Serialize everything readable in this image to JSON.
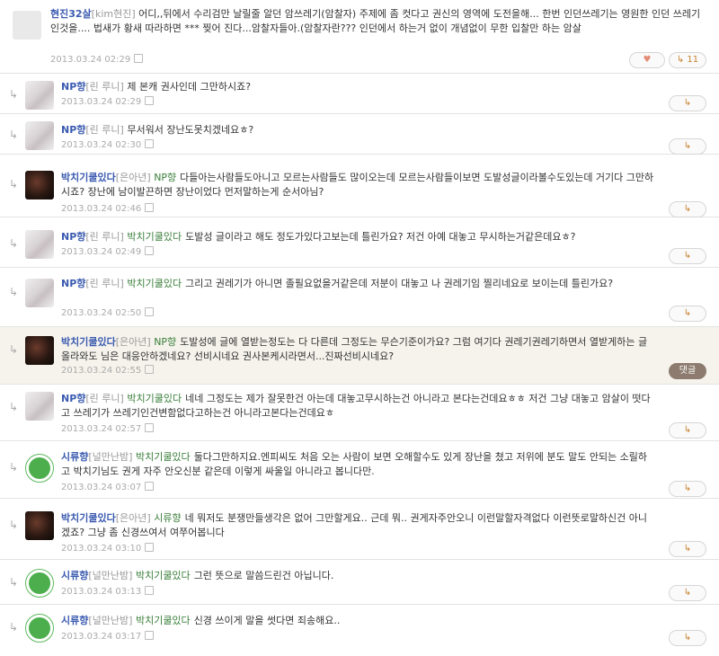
{
  "icons": {
    "reply_arrow": "↳",
    "reply": "↳",
    "heart": "♥"
  },
  "comments": [
    {
      "author": "현진32살",
      "nick": "[kim현진]",
      "target": "",
      "text": "어디,,뒤에서 수리검만 날릴줄 알던 암쓰레기(암찰자) 주제에 좀 컷다고 권신의 영역에 도전을해... 한번 인던쓰레기는 영원한 인던 쓰레기인것을.... 법새가 황새 따라하면 *** 찢어 진다...암찰자들아.(암찰자란??? 인던에서 하는거 없이 개념없이 무한 입찰만 하는 암살",
      "time": "2013.03.24 02:29",
      "likes": "11"
    },
    {
      "author": "NP향",
      "nick": "[린 루니]",
      "target": "",
      "text": "제 본캐 권사인데 그만하시죠?",
      "time": "2013.03.24 02:29"
    },
    {
      "author": "NP향",
      "nick": "[린 루니]",
      "target": "",
      "text": "무서워서 장난도못치겠네요ㅎ?",
      "time": "2013.03.24 02:30"
    },
    {
      "author": "박치기쿨있다",
      "nick": "[은아년]",
      "target": "NP향",
      "text": "다들아는사람들도아니고 모르는사람들도 많이오는데 모르는사람들이보면 도발성글이라볼수도있는데 거기다 그만하시죠? 장난에 남이발끈하면 장난이었다 먼저말하는게 순서아님?",
      "time": "2013.03.24 02:46"
    },
    {
      "author": "NP향",
      "nick": "[린 루니]",
      "target": "박치기쿨있다",
      "text": "도발성 글이라고 해도 정도가있다고보는데 틀린가요? 저건 아예 대놓고 무시하는거같은데요ㅎ?",
      "time": "2013.03.24 02:49"
    },
    {
      "author": "NP향",
      "nick": "[린 루니]",
      "target": "박치기쿨있다",
      "text": "그리고 권레기가 아니면 졸필요없을거같은데 저분이 대놓고 나 권레기임 찔리네요로 보이는데 틀린가요?",
      "time": "2013.03.24 02:50"
    },
    {
      "author": "박치기쿨있다",
      "nick": "[은아년]",
      "target": "NP향",
      "text": "도발성에 글에 열받는정도는 다 다른데 그정도는 무슨기준이가요? 그럼 여기다 권레기권레기하면서 열받게하는 글 올라와도 님은 대응안하겠네요? 선비시네요 권사본케시라면서...진짜선비시네요?",
      "time": "2013.03.24 02:55",
      "reply_label": "댓글"
    },
    {
      "author": "NP향",
      "nick": "[린 루니]",
      "target": "박치기쿨있다",
      "text": "네네 그정도는 제가 잘못한건 아는데 대놓고무시하는건 아니라고 본다는건데요ㅎㅎ 저건 그냥 대놓고 암살이 떳다고 쓰레기가 쓰레기인건변함없다고하는건 아니라고본다는건데요ㅎ",
      "time": "2013.03.24 02:57"
    },
    {
      "author": "시류향",
      "nick": "[널만난밤]",
      "target": "박치기쿨있다",
      "text": "둘다그만하지요.엔피씨도 처음 오는 사람이 보면 오해할수도 있게 장난을 쳤고 저위에 분도 말도 안되는 소릴하고 박치기님도 권게 자주 안오신분 같은데 이렇게 싸울일 아니라고 봅니다만.",
      "time": "2013.03.24 03:07"
    },
    {
      "author": "박치기쿨있다",
      "nick": "[은아년]",
      "target": "시류향",
      "text": "네 뭐저도 분쟁만들생각은 없어 그만할게요.. 근데 뭐.. 권게자주안오니 이런말할자격없다 이런뜻로말하신건 아니겠죠? 그냥 좀 신경쓰여서 여쭈어봅니다",
      "time": "2013.03.24 03:10"
    },
    {
      "author": "시류향",
      "nick": "[널만난밤]",
      "target": "박치기쿨있다",
      "text": "그런 뜻으로 말씀드린건 아닙니다.",
      "time": "2013.03.24 03:13"
    },
    {
      "author": "시류향",
      "nick": "[널만난밤]",
      "target": "박치기쿨있다",
      "text": "신경 쓰이게 말을 썻다면 죄송해요..",
      "time": "2013.03.24 03:17"
    }
  ]
}
